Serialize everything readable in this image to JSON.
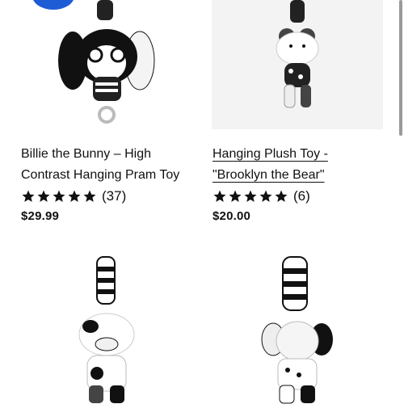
{
  "products": [
    {
      "title_line1": "Billie the Bunny – High",
      "title_line2": "Contrast Hanging Pram Toy",
      "reviews": "(37)",
      "price": "$29.99",
      "rating": 5
    },
    {
      "title_line1": "Hanging Plush Toy -",
      "title_line2": "\"Brooklyn the Bear\"",
      "reviews": "(6)",
      "price": "$20.00",
      "rating": 5
    },
    {
      "title_line1": "",
      "title_line2": "",
      "reviews": "",
      "price": "",
      "rating": 0
    },
    {
      "title_line1": "",
      "title_line2": "",
      "reviews": "",
      "price": "",
      "rating": 0
    }
  ],
  "icons": {
    "star": "star-icon",
    "badge": "sale-badge"
  },
  "colors": {
    "text": "#111111",
    "badge": "#1e5cd6",
    "image_bg": "#f3f3f3"
  }
}
